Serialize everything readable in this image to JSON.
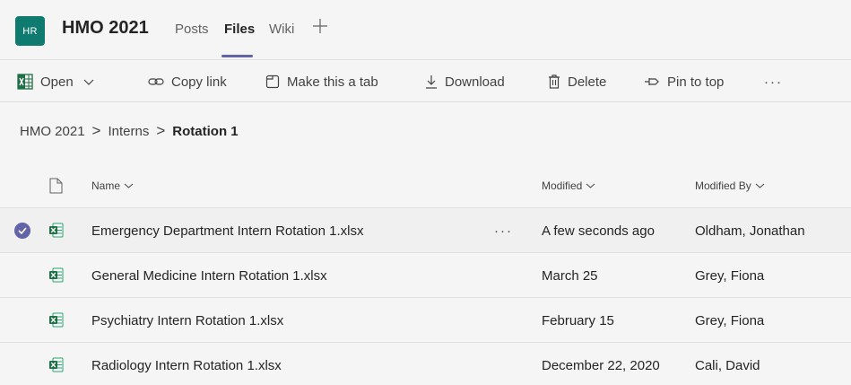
{
  "colors": {
    "avatar_bg": "#0e7a70",
    "accent": "#6264a7",
    "excel_green": "#1d7044"
  },
  "header": {
    "avatar_initials": "HR",
    "team_name": "HMO 2021",
    "tabs": [
      {
        "label": "Posts",
        "active": false
      },
      {
        "label": "Files",
        "active": true
      },
      {
        "label": "Wiki",
        "active": false
      }
    ],
    "add_tab_icon": "plus-icon"
  },
  "toolbar": {
    "open": {
      "label": "Open",
      "icon": "excel-grid-icon"
    },
    "copy_link": {
      "label": "Copy link",
      "icon": "link-icon"
    },
    "make_tab": {
      "label": "Make this a tab",
      "icon": "tab-icon"
    },
    "download": {
      "label": "Download",
      "icon": "download-icon"
    },
    "delete": {
      "label": "Delete",
      "icon": "trash-icon"
    },
    "pin": {
      "label": "Pin to top",
      "icon": "pin-icon"
    },
    "more": "···"
  },
  "breadcrumb": {
    "items": [
      "HMO 2021",
      "Interns"
    ],
    "current": "Rotation 1",
    "separator": ">"
  },
  "table": {
    "columns": {
      "name": "Name",
      "modified": "Modified",
      "modified_by": "Modified By"
    },
    "rows": [
      {
        "name": "Emergency Department Intern Rotation 1.xlsx",
        "modified": "A few seconds ago",
        "modified_by": "Oldham, Jonathan",
        "selected": true,
        "more": "···"
      },
      {
        "name": "General Medicine Intern Rotation 1.xlsx",
        "modified": "March 25",
        "modified_by": "Grey, Fiona",
        "selected": false
      },
      {
        "name": "Psychiatry Intern Rotation 1.xlsx",
        "modified": "February 15",
        "modified_by": "Grey, Fiona",
        "selected": false
      },
      {
        "name": "Radiology Intern Rotation 1.xlsx",
        "modified": "December 22, 2020",
        "modified_by": "Cali, David",
        "selected": false
      }
    ]
  }
}
